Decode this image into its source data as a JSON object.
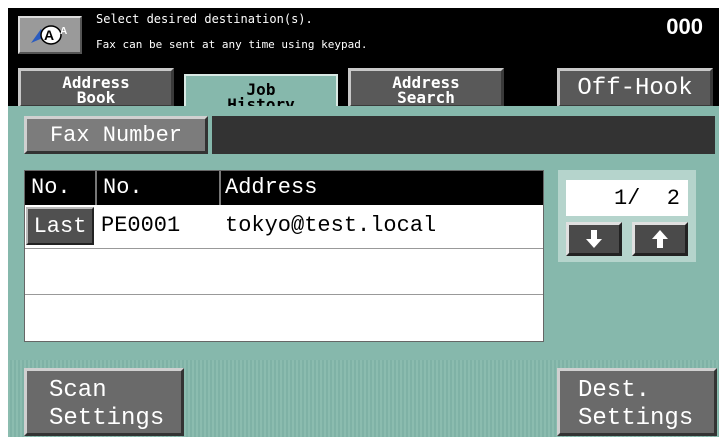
{
  "header": {
    "message_line1": "Select desired destination(s).",
    "message_line2": "Fax can be sent at any time using keypad.",
    "counter": "000",
    "logo_icon": "accessibility-aa-icon"
  },
  "tabs": {
    "address_book": "Address Book",
    "job_history": "Job History",
    "address_search": "Address Search",
    "off_hook": "Off-Hook"
  },
  "fax": {
    "label": "Fax Number",
    "value": ""
  },
  "table": {
    "headers": [
      "No.",
      "No.",
      "Address"
    ],
    "rows": [
      {
        "no1": "Last",
        "no2": "PE0001",
        "address": "tokyo@test.local"
      },
      {
        "no1": "",
        "no2": "",
        "address": ""
      },
      {
        "no1": "",
        "no2": "",
        "address": ""
      }
    ]
  },
  "pager": {
    "display": "1/  2",
    "down_icon": "arrow-down-icon",
    "up_icon": "arrow-up-icon"
  },
  "bottom": {
    "scan_line1": "Scan",
    "scan_line2": "Settings",
    "dest_line1": "Dest.",
    "dest_line2": "Settings"
  },
  "colors": {
    "panel": "#86b8ac",
    "header_bg": "#000000",
    "button_gray": "#595959"
  }
}
